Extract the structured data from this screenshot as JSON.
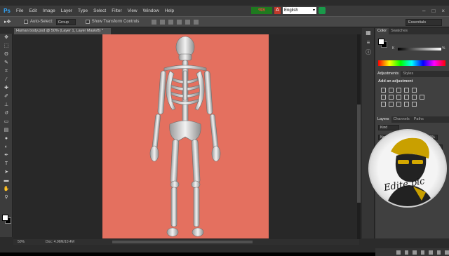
{
  "menubar": {
    "logo": "Ps",
    "items": [
      "File",
      "Edit",
      "Image",
      "Layer",
      "Type",
      "Select",
      "Filter",
      "View",
      "Window",
      "Help"
    ],
    "language_app_label": "অভ্র",
    "language_value": "English",
    "window_controls": [
      "–",
      "□",
      "×"
    ]
  },
  "options": {
    "auto_select_label": "Auto-Select:",
    "auto_select_value": "Group",
    "transform_label": "Show Transform Controls",
    "workspace": "Essentials"
  },
  "document": {
    "tab_title": "Human body.psd @ 50% (Layer 1, Layer Mask/8) *",
    "canvas_color": "#e4705f"
  },
  "status": {
    "zoom": "50%",
    "doc_size": "Doc: 4.06M/10.4M"
  },
  "panels": {
    "color_tabs": [
      "Color",
      "Swatches"
    ],
    "color_k_label": "K",
    "color_value": "%",
    "adjust_tabs": [
      "Adjustments",
      "Styles"
    ],
    "adjust_title": "Add an adjustment",
    "layers_tabs": [
      "Layers",
      "Channels",
      "Paths"
    ],
    "layers_kind": "Kind",
    "blend_mode": "Normal",
    "opacity": "100%",
    "fill": "100%"
  },
  "watermark": {
    "text": "Edite pic"
  }
}
